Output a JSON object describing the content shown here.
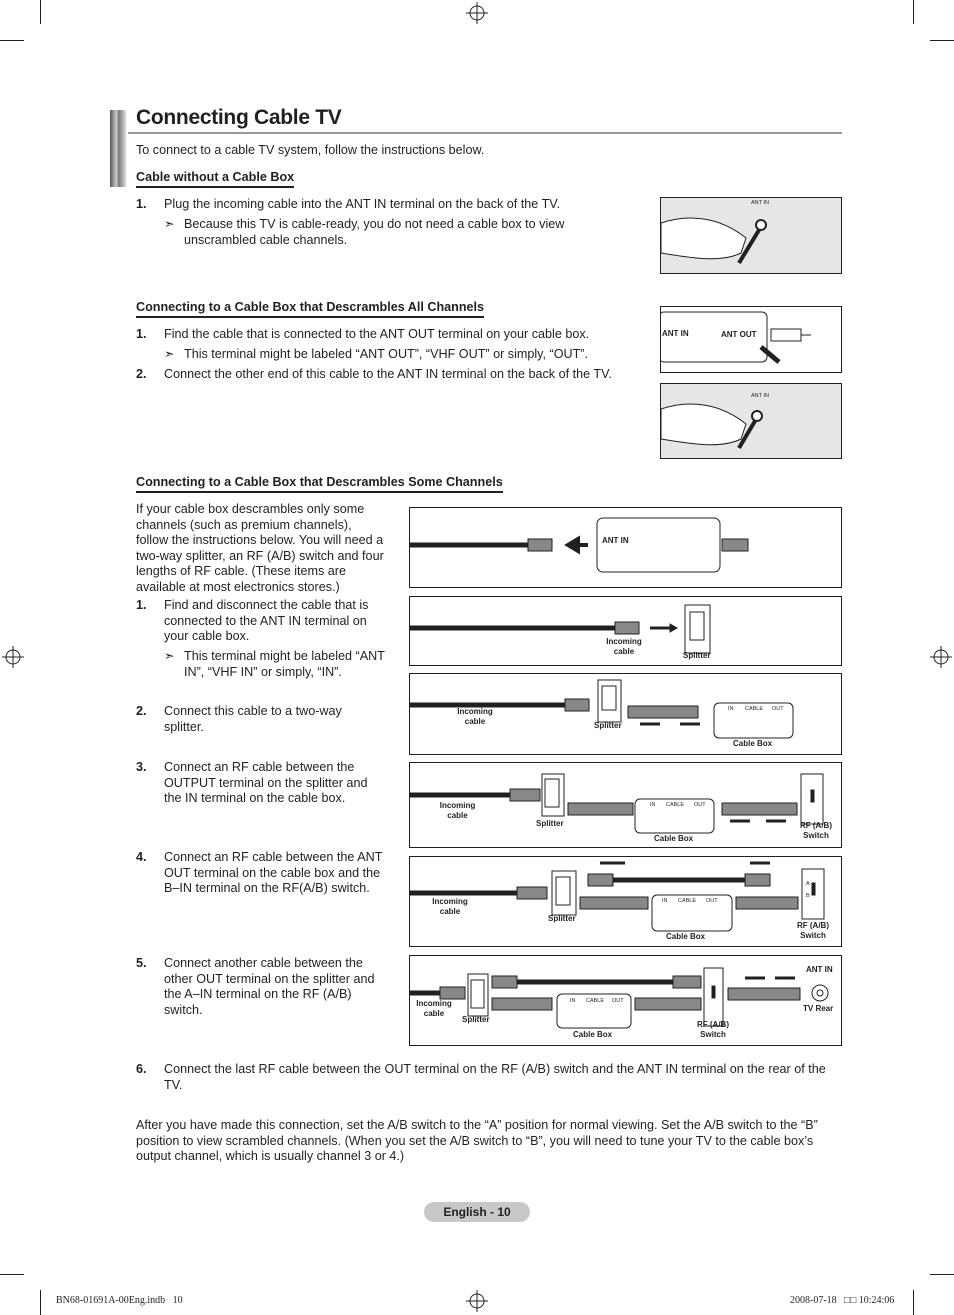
{
  "title": "Connecting Cable TV",
  "intro": "To connect to a cable TV system, follow the instructions below.",
  "section1": {
    "heading": "Cable without a Cable Box",
    "steps": [
      {
        "num": "1.",
        "text": "Plug the incoming cable into the ANT IN terminal on the back of the TV.",
        "note": "Because this TV is cable-ready, you do not need a cable box to view unscrambled cable channels."
      }
    ],
    "figure_label": "ANT IN"
  },
  "section2": {
    "heading": "Connecting to a Cable Box that Descrambles All Channels",
    "steps": [
      {
        "num": "1.",
        "text": "Find the cable that is connected to the ANT OUT terminal on your cable box.",
        "note": "This terminal might be labeled “ANT OUT”, “VHF OUT” or simply, “OUT”."
      },
      {
        "num": "2.",
        "text": "Connect the other end of this cable to the ANT IN terminal on the back of the TV."
      }
    ],
    "fig1": {
      "ant_in": "ANT IN",
      "ant_out": "ANT OUT"
    },
    "fig2": {
      "ant_in": "ANT IN"
    }
  },
  "section3": {
    "heading": "Connecting to a Cable Box that Descrambles Some Channels",
    "intro": "If your cable box descrambles only some channels (such as premium channels), follow the instructions below. You will need a two-way splitter, an RF (A/B) switch and four lengths of RF cable. (These items are available at most electronics stores.)",
    "steps": [
      {
        "num": "1.",
        "text": "Find and disconnect the cable that is connected to the ANT IN terminal on your cable box.",
        "note": "This terminal might be labeled “ANT IN”, “VHF IN” or simply, “IN”."
      },
      {
        "num": "2.",
        "text": "Connect this cable to a two-way splitter."
      },
      {
        "num": "3.",
        "text": "Connect an RF cable between the OUTPUT terminal on the splitter and the IN terminal on the cable box."
      },
      {
        "num": "4.",
        "text": "Connect an RF cable between the ANT OUT terminal on the cable box and the B–IN terminal on the RF(A/B) switch."
      },
      {
        "num": "5.",
        "text": "Connect another cable between the other OUT terminal on the splitter and the A–IN terminal on the RF (A/B) switch."
      },
      {
        "num": "6.",
        "text": "Connect the last RF cable between the OUT terminal on the RF (A/B) switch and the ANT IN terminal on the rear of the TV."
      }
    ],
    "outro": "After you have made this connection, set the A/B switch to the “A” position for normal viewing. Set the A/B switch to the “B” position to view scrambled channels. (When you set the A/B switch to “B”, you will need to tune your TV to the cable box’s output channel, which is usually channel 3 or 4.)",
    "labels": {
      "ant_in": "ANT IN",
      "incoming": "Incoming cable",
      "splitter": "Splitter",
      "cable_box": "Cable Box",
      "in": "IN",
      "cable": "CABLE",
      "out": "OUT",
      "rf_switch": "RF (A/B) Switch",
      "a": "A",
      "b": "B",
      "tv_rear": "TV Rear"
    }
  },
  "footer": {
    "page": "English - 10",
    "file": "BN68-01691A-00Eng.indb   10",
    "date": "2008-07-18   □□ 10:24:06"
  }
}
